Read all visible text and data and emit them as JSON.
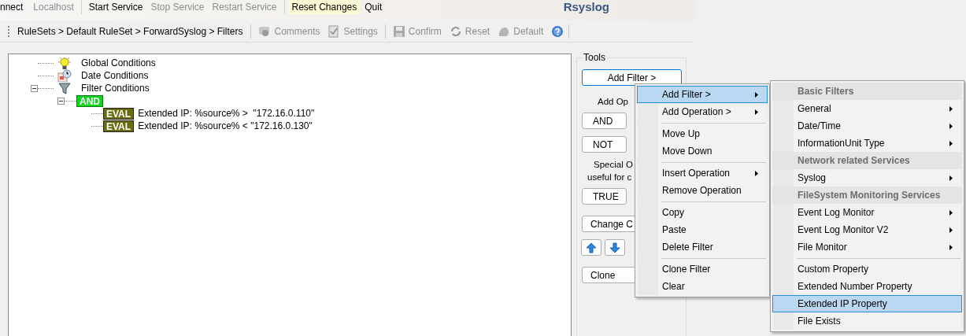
{
  "app_title": "Rsyslog",
  "toolbar": [
    {
      "kind": "button",
      "label": "nnect",
      "disabled": false,
      "highlighted": false
    },
    {
      "kind": "button",
      "label": "Localhost",
      "disabled": true,
      "highlighted": false
    },
    {
      "kind": "separator"
    },
    {
      "kind": "button",
      "label": "Start Service",
      "disabled": false,
      "highlighted": false
    },
    {
      "kind": "button",
      "label": "Stop Service",
      "disabled": true,
      "highlighted": false
    },
    {
      "kind": "button",
      "label": "Restart Service",
      "disabled": true,
      "highlighted": false
    },
    {
      "kind": "separator"
    },
    {
      "kind": "button",
      "label": "Reset Changes",
      "disabled": false,
      "highlighted": true
    },
    {
      "kind": "button",
      "label": "Quit",
      "disabled": false,
      "highlighted": false
    }
  ],
  "breadcrumb": "RuleSets > Default RuleSet > ForwardSyslog > Filters",
  "actions": [
    {
      "kind": "comments",
      "label": "Comments",
      "disabled": true
    },
    {
      "kind": "settings",
      "label": "Settings",
      "disabled": true
    },
    {
      "kind": "separator"
    },
    {
      "kind": "save",
      "label": "Confirm",
      "disabled": true
    },
    {
      "kind": "reset",
      "label": "Reset",
      "disabled": true
    },
    {
      "kind": "default",
      "label": "Default",
      "disabled": true
    },
    {
      "kind": "help"
    }
  ],
  "tree": [
    {
      "kind": "bulb",
      "label": "Global Conditions"
    },
    {
      "kind": "calendar",
      "label": "Date Conditions"
    },
    {
      "kind": "funnel",
      "label": "Filter Conditions",
      "expanded": true,
      "children": [
        {
          "kind": "operator",
          "label": "AND",
          "expanded": true,
          "children": [
            {
              "kind": "eval",
              "badge": "EVAL",
              "label": "Extended IP: %source% >  \"172.16.0.110\""
            },
            {
              "kind": "eval",
              "badge": "EVAL",
              "label": "Extended IP: %source% < \"172.16.0.130\""
            }
          ]
        }
      ]
    }
  ],
  "tools": {
    "title": "Tools",
    "items": [
      {
        "kind": "wide-button",
        "label": "Add Filter >"
      },
      {
        "kind": "text",
        "label": "Add Op"
      },
      {
        "kind": "button",
        "label": "AND"
      },
      {
        "kind": "button",
        "label": "NOT"
      },
      {
        "kind": "text",
        "label": "Special O"
      },
      {
        "kind": "text",
        "label": "useful for c"
      },
      {
        "kind": "button",
        "label": "TRUE"
      },
      {
        "kind": "wide-button",
        "label": "Change C"
      },
      {
        "kind": "arrows"
      },
      {
        "kind": "wide-button",
        "label": "Clone"
      }
    ]
  },
  "context_menu": [
    {
      "kind": "item",
      "label": "Add Filter >",
      "submenu": true,
      "selected": true
    },
    {
      "kind": "item",
      "label": "Add Operation >",
      "submenu": true,
      "selected": false
    },
    {
      "kind": "separator"
    },
    {
      "kind": "item",
      "label": "Move Up",
      "submenu": false,
      "selected": false
    },
    {
      "kind": "item",
      "label": "Move Down",
      "submenu": false,
      "selected": false
    },
    {
      "kind": "separator"
    },
    {
      "kind": "item",
      "label": "Insert Operation",
      "submenu": true,
      "selected": false
    },
    {
      "kind": "item",
      "label": "Remove Operation",
      "submenu": false,
      "selected": false
    },
    {
      "kind": "separator"
    },
    {
      "kind": "item",
      "label": "Copy",
      "submenu": false,
      "selected": false
    },
    {
      "kind": "item",
      "label": "Paste",
      "submenu": false,
      "selected": false
    },
    {
      "kind": "item",
      "label": "Delete Filter",
      "submenu": false,
      "selected": false
    },
    {
      "kind": "separator"
    },
    {
      "kind": "item",
      "label": "Clone Filter",
      "submenu": false,
      "selected": false
    },
    {
      "kind": "item",
      "label": "Clear",
      "submenu": false,
      "selected": false
    }
  ],
  "submenu": [
    {
      "kind": "header",
      "label": "Basic Filters"
    },
    {
      "kind": "item",
      "label": "General",
      "submenu": true,
      "selected": false
    },
    {
      "kind": "item",
      "label": "Date/Time",
      "submenu": true,
      "selected": false
    },
    {
      "kind": "item",
      "label": "InformationUnit Type",
      "submenu": true,
      "selected": false
    },
    {
      "kind": "header",
      "label": "Network related Services"
    },
    {
      "kind": "item",
      "label": "Syslog",
      "submenu": true,
      "selected": false
    },
    {
      "kind": "header",
      "label": "FileSystem Monitoring Services"
    },
    {
      "kind": "item",
      "label": "Event Log Monitor",
      "submenu": true,
      "selected": false
    },
    {
      "kind": "item",
      "label": "Event Log Monitor V2",
      "submenu": true,
      "selected": false
    },
    {
      "kind": "item",
      "label": "File Monitor",
      "submenu": true,
      "selected": false
    },
    {
      "kind": "separator"
    },
    {
      "kind": "item",
      "label": "Custom Property",
      "submenu": false,
      "selected": false
    },
    {
      "kind": "item",
      "label": "Extended Number Property",
      "submenu": false,
      "selected": false
    },
    {
      "kind": "item",
      "label": "Extended IP Property",
      "submenu": false,
      "selected": true
    },
    {
      "kind": "item",
      "label": "File Exists",
      "submenu": false,
      "selected": false
    }
  ]
}
